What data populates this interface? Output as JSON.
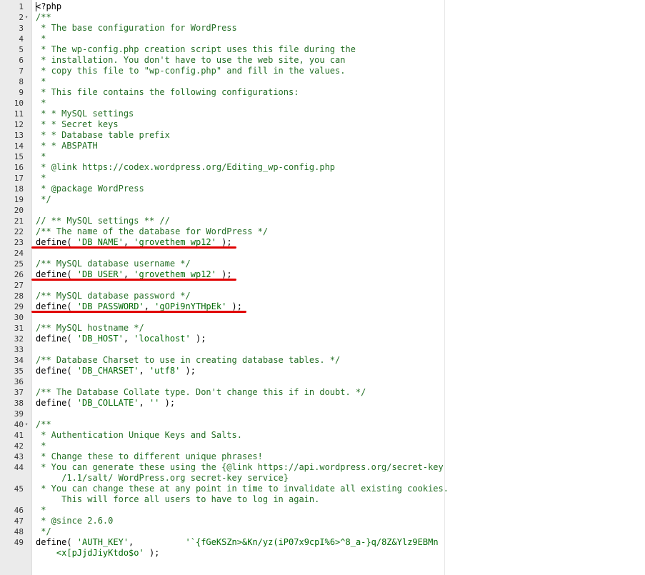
{
  "editor": {
    "language": "php",
    "lines": [
      {
        "n": "1",
        "kind": "php",
        "text": "<?php"
      },
      {
        "n": "2",
        "kind": "cmt",
        "fold": "▾",
        "text": "/**"
      },
      {
        "n": "3",
        "kind": "cmt",
        "text": " * The base configuration for WordPress"
      },
      {
        "n": "4",
        "kind": "cmt",
        "text": " *"
      },
      {
        "n": "5",
        "kind": "cmt",
        "text": " * The wp-config.php creation script uses this file during the"
      },
      {
        "n": "6",
        "kind": "cmt",
        "text": " * installation. You don't have to use the web site, you can"
      },
      {
        "n": "7",
        "kind": "cmt",
        "text": " * copy this file to \"wp-config.php\" and fill in the values."
      },
      {
        "n": "8",
        "kind": "cmt",
        "text": " *"
      },
      {
        "n": "9",
        "kind": "cmt",
        "text": " * This file contains the following configurations:"
      },
      {
        "n": "10",
        "kind": "cmt",
        "text": " *"
      },
      {
        "n": "11",
        "kind": "cmt",
        "text": " * * MySQL settings"
      },
      {
        "n": "12",
        "kind": "cmt",
        "text": " * * Secret keys"
      },
      {
        "n": "13",
        "kind": "cmt",
        "text": " * * Database table prefix"
      },
      {
        "n": "14",
        "kind": "cmt",
        "text": " * * ABSPATH"
      },
      {
        "n": "15",
        "kind": "cmt",
        "text": " *"
      },
      {
        "n": "16",
        "kind": "cmt",
        "text": " * @link https://codex.wordpress.org/Editing_wp-config.php"
      },
      {
        "n": "17",
        "kind": "cmt",
        "text": " *"
      },
      {
        "n": "18",
        "kind": "cmt",
        "text": " * @package WordPress"
      },
      {
        "n": "19",
        "kind": "cmt",
        "text": " */"
      },
      {
        "n": "20",
        "kind": "blank",
        "text": ""
      },
      {
        "n": "21",
        "kind": "cmt",
        "text": "// ** MySQL settings ** //"
      },
      {
        "n": "22",
        "kind": "cmt",
        "text": "/** The name of the database for WordPress */"
      },
      {
        "n": "23",
        "kind": "def",
        "fn": "define( ",
        "key": "'DB_NAME'",
        "sep": ", ",
        "val": "'grovethem_wp12'",
        "end": " );",
        "underline": "db-name"
      },
      {
        "n": "24",
        "kind": "blank",
        "text": ""
      },
      {
        "n": "25",
        "kind": "cmt",
        "text": "/** MySQL database username */"
      },
      {
        "n": "26",
        "kind": "def",
        "fn": "define( ",
        "key": "'DB_USER'",
        "sep": ", ",
        "val": "'grovethem_wp12'",
        "end": " );",
        "underline": "db-user"
      },
      {
        "n": "27",
        "kind": "blank",
        "text": ""
      },
      {
        "n": "28",
        "kind": "cmt",
        "text": "/** MySQL database password */"
      },
      {
        "n": "29",
        "kind": "def",
        "fn": "define( ",
        "key": "'DB_PASSWORD'",
        "sep": ", ",
        "val": "'gOPi9nYTHpEk'",
        "end": " );",
        "underline": "db-password"
      },
      {
        "n": "30",
        "kind": "blank",
        "text": ""
      },
      {
        "n": "31",
        "kind": "cmt",
        "text": "/** MySQL hostname */"
      },
      {
        "n": "32",
        "kind": "def",
        "fn": "define( ",
        "key": "'DB_HOST'",
        "sep": ", ",
        "val": "'localhost'",
        "end": " );"
      },
      {
        "n": "33",
        "kind": "blank",
        "text": ""
      },
      {
        "n": "34",
        "kind": "cmt",
        "text": "/** Database Charset to use in creating database tables. */"
      },
      {
        "n": "35",
        "kind": "def",
        "fn": "define( ",
        "key": "'DB_CHARSET'",
        "sep": ", ",
        "val": "'utf8'",
        "end": " );"
      },
      {
        "n": "36",
        "kind": "blank",
        "text": ""
      },
      {
        "n": "37",
        "kind": "cmt",
        "text": "/** The Database Collate type. Don't change this if in doubt. */"
      },
      {
        "n": "38",
        "kind": "def",
        "fn": "define( ",
        "key": "'DB_COLLATE'",
        "sep": ", ",
        "val": "''",
        "end": " );"
      },
      {
        "n": "39",
        "kind": "blank",
        "text": ""
      },
      {
        "n": "40",
        "kind": "cmt",
        "fold": "▾",
        "text": "/**"
      },
      {
        "n": "41",
        "kind": "cmt",
        "text": " * Authentication Unique Keys and Salts."
      },
      {
        "n": "42",
        "kind": "cmt",
        "text": " *"
      },
      {
        "n": "43",
        "kind": "cmt",
        "text": " * Change these to different unique phrases!"
      },
      {
        "n": "44",
        "kind": "cmt",
        "text": " * You can generate these using the {@link https://api.wordpress.org/secret-key"
      },
      {
        "n": "",
        "kind": "cmt",
        "text": "     /1.1/salt/ WordPress.org secret-key service}"
      },
      {
        "n": "45",
        "kind": "cmt",
        "text": " * You can change these at any point in time to invalidate all existing cookies."
      },
      {
        "n": "",
        "kind": "cmt",
        "text": "     This will force all users to have to log in again."
      },
      {
        "n": "46",
        "kind": "cmt",
        "text": " *"
      },
      {
        "n": "47",
        "kind": "cmt",
        "text": " * @since 2.6.0"
      },
      {
        "n": "48",
        "kind": "cmt",
        "text": " */"
      },
      {
        "n": "49",
        "kind": "def",
        "fn": "define( ",
        "key": "'AUTH_KEY'",
        "sep": ",          ",
        "val": "'`{fGeKSZn>&Kn/yz(iP07x9cpI%6>^8_a-}q/8Z&Ylz9EBMn",
        "end": ""
      },
      {
        "n": "",
        "kind": "str",
        "text": "    <x[pJjdJiyKtdo$o'",
        "tail": " );"
      }
    ]
  },
  "highlight_color": "#e00000"
}
